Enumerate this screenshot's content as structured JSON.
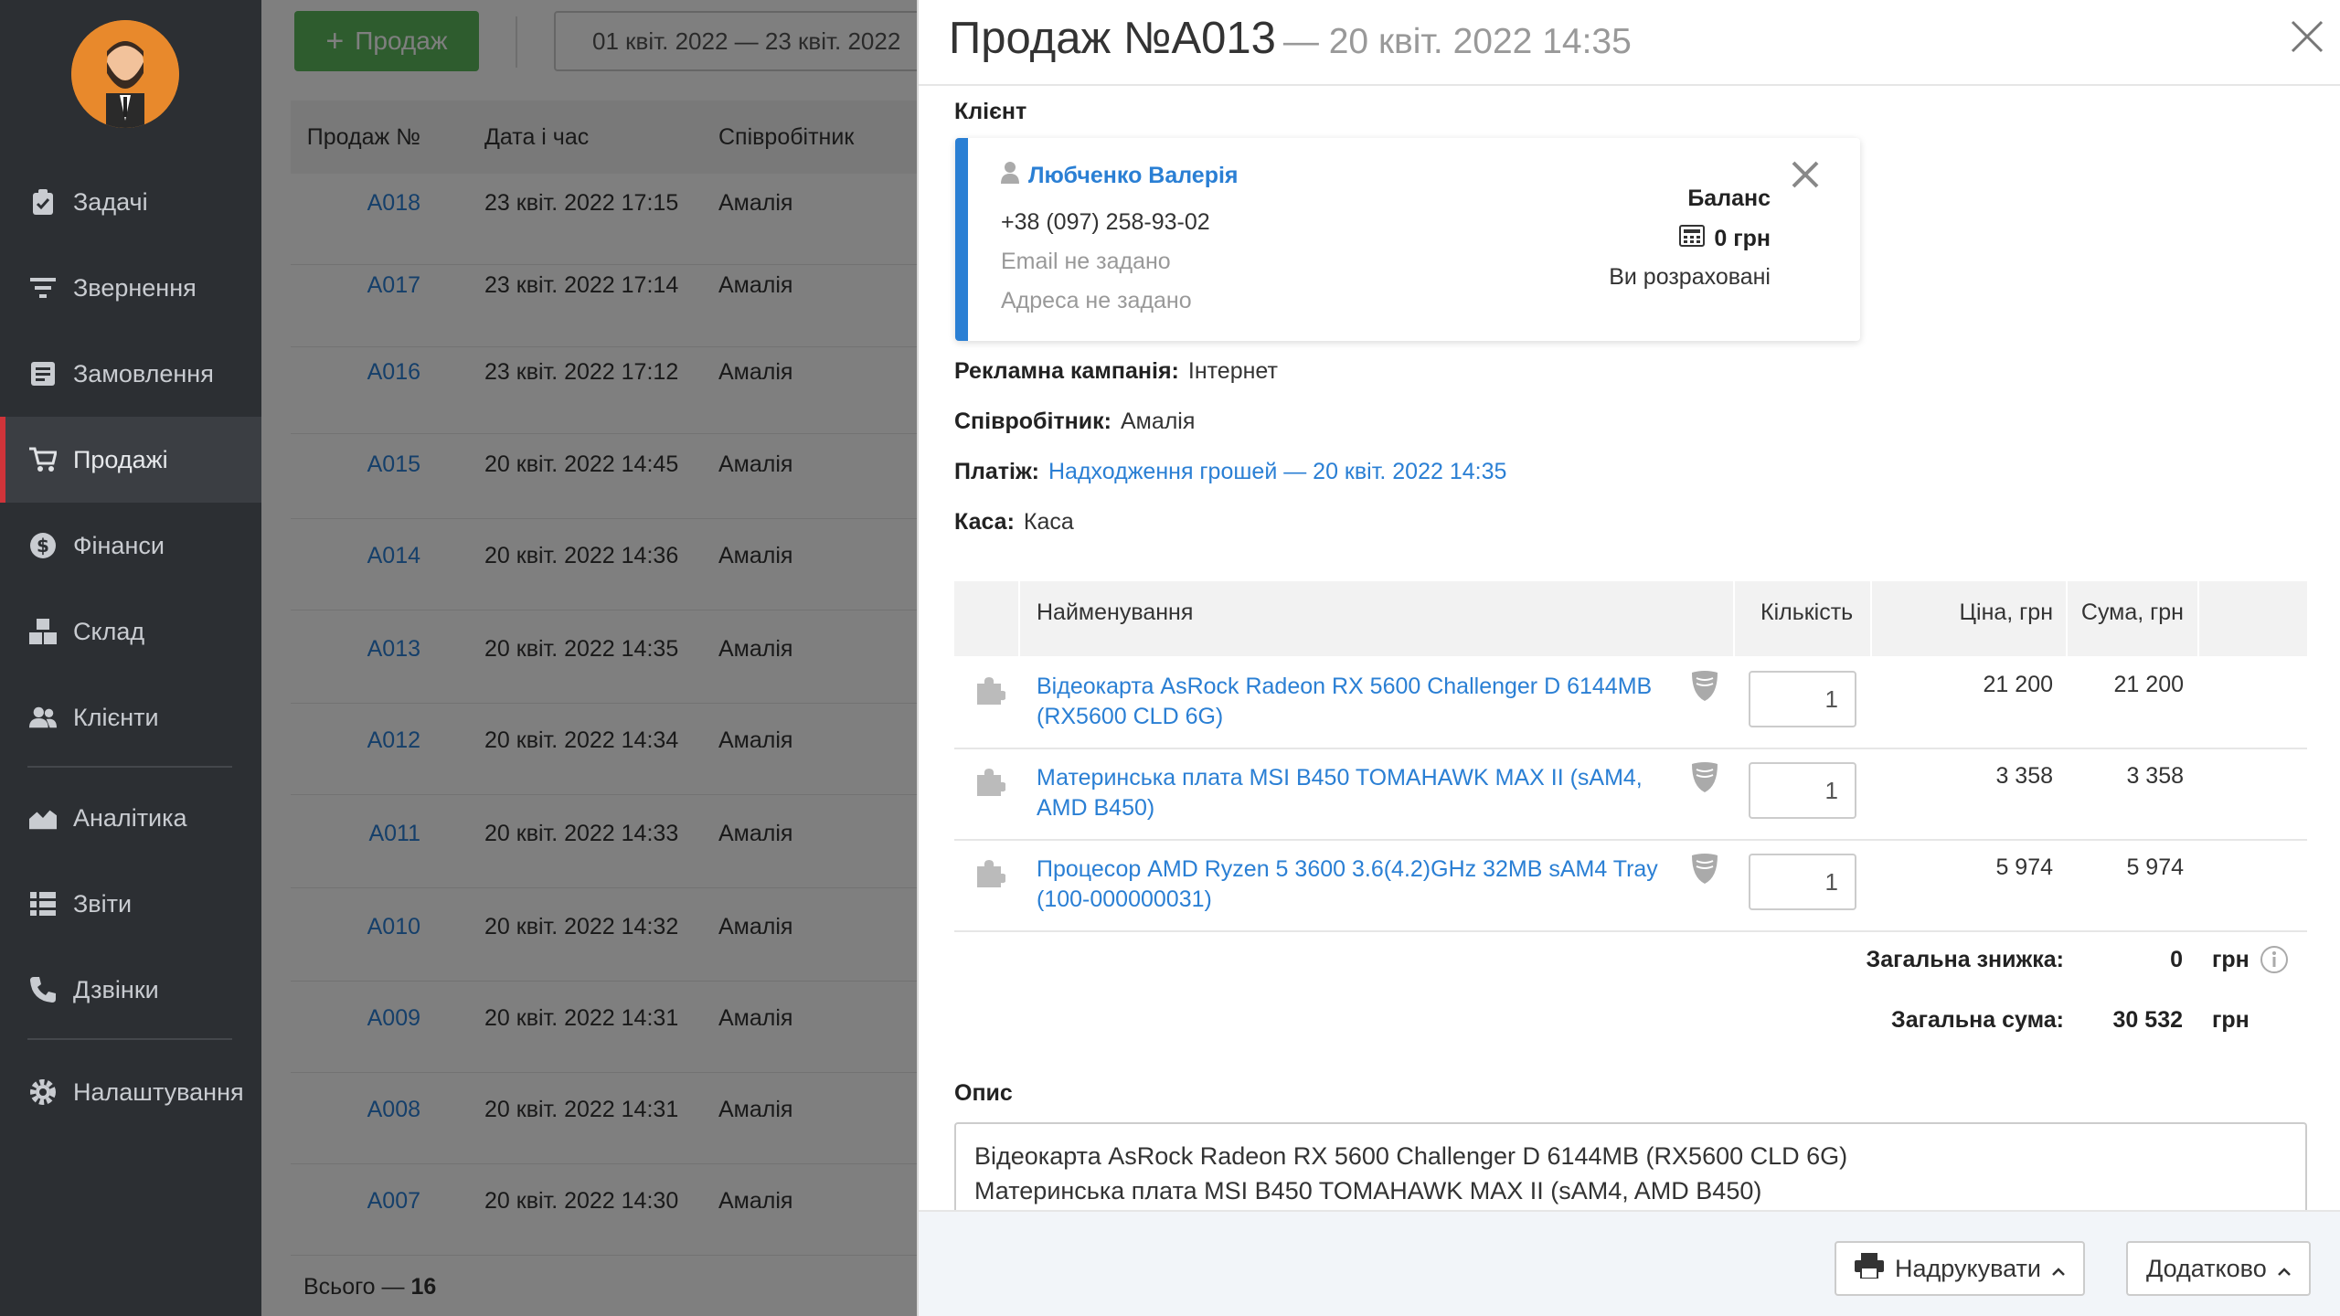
{
  "sidebar": {
    "items": [
      {
        "label": "Задачі",
        "icon": "clipboard-icon"
      },
      {
        "label": "Звернення",
        "icon": "filter-icon"
      },
      {
        "label": "Замовлення",
        "icon": "order-icon"
      },
      {
        "label": "Продажі",
        "icon": "cart-icon",
        "active": true
      },
      {
        "label": "Фінанси",
        "icon": "dollar-icon"
      },
      {
        "label": "Склад",
        "icon": "boxes-icon"
      },
      {
        "label": "Клієнти",
        "icon": "users-icon"
      },
      {
        "label": "Аналітика",
        "icon": "chart-icon"
      },
      {
        "label": "Звіти",
        "icon": "report-icon"
      },
      {
        "label": "Дзвінки",
        "icon": "phone-icon"
      },
      {
        "label": "Налаштування",
        "icon": "gear-icon"
      }
    ]
  },
  "toolbar": {
    "add_label": "Продаж",
    "date_range": "01 квіт. 2022 — 23 квіт. 2022"
  },
  "list": {
    "headers": {
      "num": "Продаж №",
      "date": "Дата і час",
      "employee": "Співробітник"
    },
    "rows": [
      {
        "num": "A018",
        "date": "23 квіт. 2022 17:15",
        "employee": "Амалія"
      },
      {
        "num": "A017",
        "date": "23 квіт. 2022 17:14",
        "employee": "Амалія"
      },
      {
        "num": "A016",
        "date": "23 квіт. 2022 17:12",
        "employee": "Амалія"
      },
      {
        "num": "A015",
        "date": "20 квіт. 2022 14:45",
        "employee": "Амалія"
      },
      {
        "num": "A014",
        "date": "20 квіт. 2022 14:36",
        "employee": "Амалія"
      },
      {
        "num": "A013",
        "date": "20 квіт. 2022 14:35",
        "employee": "Амалія"
      },
      {
        "num": "A012",
        "date": "20 квіт. 2022 14:34",
        "employee": "Амалія"
      },
      {
        "num": "A011",
        "date": "20 квіт. 2022 14:33",
        "employee": "Амалія"
      },
      {
        "num": "A010",
        "date": "20 квіт. 2022 14:32",
        "employee": "Амалія"
      },
      {
        "num": "A009",
        "date": "20 квіт. 2022 14:31",
        "employee": "Амалія"
      },
      {
        "num": "A008",
        "date": "20 квіт. 2022 14:31",
        "employee": "Амалія"
      },
      {
        "num": "A007",
        "date": "20 квіт. 2022 14:30",
        "employee": "Амалія"
      }
    ],
    "total_label": "Всього —",
    "total_count": "16"
  },
  "panel": {
    "title": "Продаж №A013",
    "subtitle": "— 20 квіт. 2022 14:35",
    "client_label": "Клієнт",
    "client": {
      "name": "Любченко Валерія",
      "phone": "+38 (097) 258-93-02",
      "email": "Email не задано",
      "address": "Адреса не задано",
      "balance_label": "Баланс",
      "balance_value": "0 грн",
      "balance_status": "Ви розраховані"
    },
    "campaign_label": "Рекламна кампанія:",
    "campaign_value": "Інтернет",
    "employee_label": "Співробітник:",
    "employee_value": "Амалія",
    "payment_label": "Платіж:",
    "payment_value": "Надходження грошей — 20 квіт. 2022 14:35",
    "cashbox_label": "Каса:",
    "cashbox_value": "Каса",
    "items_headers": {
      "name": "Найменування",
      "qty": "Кількість",
      "price": "Ціна, грн",
      "sum": "Сума, грн"
    },
    "items": [
      {
        "name": "Відеокарта AsRock Radeon RX 5600 Challenger D 6144MB (RX5600 CLD 6G)",
        "qty": "1",
        "price": "21 200",
        "sum": "21 200"
      },
      {
        "name": "Материнська плата MSI B450 TOMAHAWK MAX II (sAM4, AMD B450)",
        "qty": "1",
        "price": "3 358",
        "sum": "3 358"
      },
      {
        "name": "Процесор AMD Ryzen 5 3600 3.6(4.2)GHz 32MB sAM4 Tray (100-000000031)",
        "qty": "1",
        "price": "5 974",
        "sum": "5 974"
      }
    ],
    "discount_label": "Загальна знижка:",
    "discount_value": "0",
    "discount_unit": "грн",
    "total_label": "Загальна сума:",
    "total_value": "30 532",
    "total_unit": "грн",
    "description_label": "Опис",
    "description_lines": [
      "Відеокарта AsRock Radeon RX 5600 Challenger D 6144MB (RX5600 CLD 6G)",
      "Материнська плата MSI B450 TOMAHAWK MAX II (sAM4, AMD B450)"
    ],
    "print_label": "Надрукувати",
    "more_label": "Додатково"
  },
  "colors": {
    "accent": "#2a7fd4",
    "sidebar": "#2c2f33",
    "active_marker": "#d0343a",
    "add_button": "#5cb85c"
  }
}
